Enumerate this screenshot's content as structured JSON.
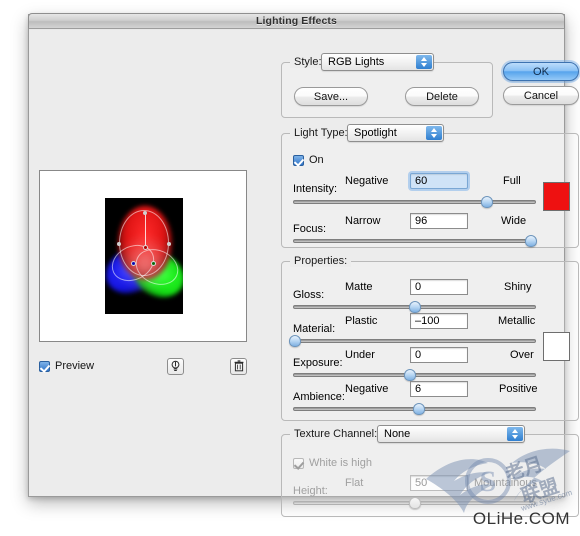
{
  "window": {
    "title": "Lighting Effects"
  },
  "buttons": {
    "ok": "OK",
    "cancel": "Cancel"
  },
  "style_group": {
    "legend": "Style:",
    "selected": "RGB Lights",
    "save_label": "Save...",
    "delete_label": "Delete"
  },
  "light_type_group": {
    "legend": "Light Type:",
    "selected": "Spotlight",
    "on_label": "On",
    "on_checked": true,
    "light_color": "#ee1111",
    "intensity": {
      "label": "Intensity:",
      "min_label": "Negative",
      "max_label": "Full",
      "value": "60",
      "percent": 80
    },
    "focus": {
      "label": "Focus:",
      "min_label": "Narrow",
      "max_label": "Wide",
      "value": "96",
      "percent": 98
    }
  },
  "properties_group": {
    "legend": "Properties:",
    "material_color": "#ffffff",
    "gloss": {
      "label": "Gloss:",
      "min_label": "Matte",
      "max_label": "Shiny",
      "value": "0",
      "percent": 50
    },
    "material": {
      "label": "Material:",
      "min_label": "Plastic",
      "max_label": "Metallic",
      "value": "–100",
      "percent": 1
    },
    "exposure": {
      "label": "Exposure:",
      "min_label": "Under",
      "max_label": "Over",
      "value": "0",
      "percent": 48
    },
    "ambience": {
      "label": "Ambience:",
      "min_label": "Negative",
      "max_label": "Positive",
      "value": "6",
      "percent": 52
    }
  },
  "texture_group": {
    "legend": "Texture Channel:",
    "selected": "None",
    "white_is_high_label": "White is high",
    "white_is_high_checked": true,
    "height": {
      "label": "Height:",
      "min_label": "Flat",
      "max_label": "Mountainous",
      "value": "50",
      "percent": 50
    }
  },
  "preview": {
    "checkbox_label": "Preview",
    "checked": true,
    "light_bulb_icon": "light-bulb-icon",
    "trash_icon": "trash-icon"
  },
  "watermark": {
    "text": "OLiHe.COM"
  }
}
